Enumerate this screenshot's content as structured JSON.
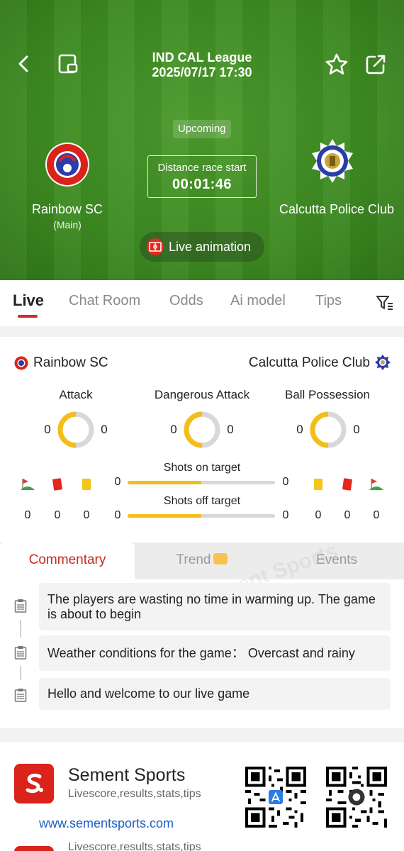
{
  "header": {
    "league": "IND CAL League",
    "datetime": "2025/07/17 17:30",
    "status": "Upcoming",
    "countdown_label": "Distance race start",
    "countdown_value": "00:01:46",
    "live_animation_label": "Live animation"
  },
  "home": {
    "name": "Rainbow SC",
    "sub": "(Main)",
    "color": "#d9231b"
  },
  "away": {
    "name": "Calcutta Police Club",
    "color": "#2b3da8"
  },
  "tabs": [
    {
      "label": "Live",
      "active": true
    },
    {
      "label": "Chat Room"
    },
    {
      "label": "Odds"
    },
    {
      "label": "Ai model"
    },
    {
      "label": "Tips"
    }
  ],
  "stats": {
    "home_name": "Rainbow SC",
    "away_name": "Calcutta Police Club",
    "metrics": [
      {
        "label": "Attack",
        "home": "0",
        "away": "0"
      },
      {
        "label": "Dangerous Attack",
        "home": "0",
        "away": "0"
      },
      {
        "label": "Ball Possession",
        "home": "0",
        "away": "0"
      }
    ],
    "home_corners": "0",
    "home_red": "0",
    "home_yellow": "0",
    "away_yellow": "0",
    "away_red": "0",
    "away_corners": "0",
    "shots_on_label": "Shots on target",
    "shots_on_home": "0",
    "shots_on_away": "0",
    "shots_off_label": "Shots off target",
    "shots_off_home": "0",
    "shots_off_away": "0",
    "accent": "#f5bd17"
  },
  "commentary": {
    "tabs": [
      {
        "label": "Commentary",
        "active": true
      },
      {
        "label": "Trend"
      },
      {
        "label": "Events"
      }
    ],
    "items": [
      "The players are wasting no time in warming up. The game is about to begin",
      "Weather conditions for the game： Overcast and rainy",
      "Hello and welcome to our live game"
    ]
  },
  "promo": {
    "app_name": "Sement Sports",
    "tagline": "Livescore,results,stats,tips",
    "url": "www.sementsports.com",
    "tagline_repeat": "Livescore,results,stats,tips",
    "watermark": "Sement Sports"
  }
}
